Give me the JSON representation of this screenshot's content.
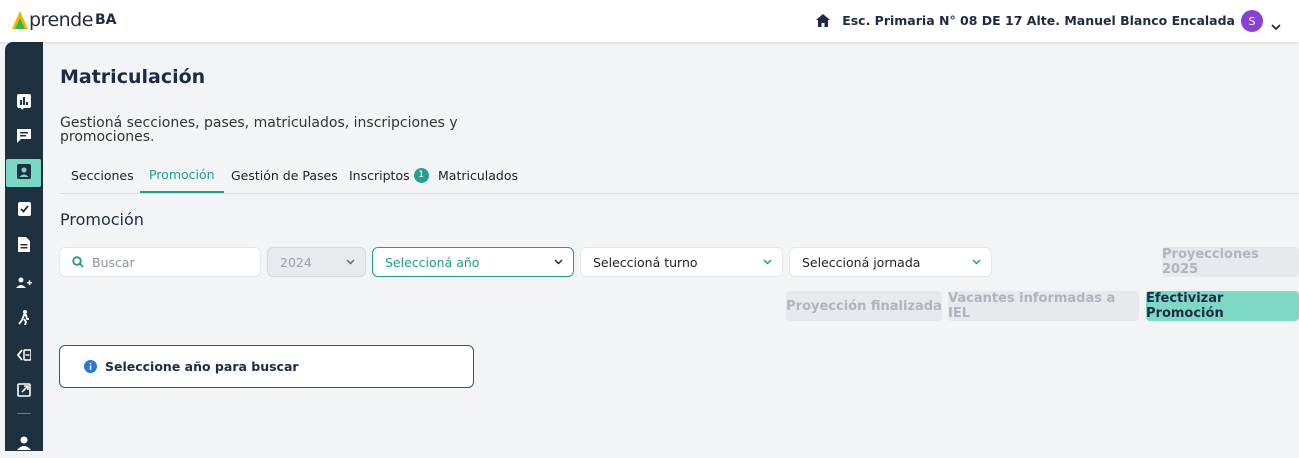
{
  "header": {
    "logo_word": "prende",
    "logo_suffix": "BA",
    "school_name": "Esc. Primaria N° 08 DE 17 Alte. Manuel Blanco Encalada",
    "avatar_initial": "S"
  },
  "sidebar": {
    "items": [
      {
        "icon": "chevron-right-icon"
      },
      {
        "icon": "bar-chart-icon"
      },
      {
        "icon": "chat-icon"
      },
      {
        "icon": "contact-badge-icon",
        "active": true
      },
      {
        "icon": "clipboard-check-icon"
      },
      {
        "icon": "document-icon"
      },
      {
        "icon": "group-add-icon"
      },
      {
        "icon": "running-person-icon"
      },
      {
        "icon": "transfer-icon"
      },
      {
        "icon": "external-link-icon"
      },
      {
        "icon": "person-icon"
      }
    ]
  },
  "page": {
    "title": "Matriculación",
    "subtitle": "Gestioná secciones, pases, matriculados, inscripciones y promociones."
  },
  "tabs": [
    {
      "label": "Secciones"
    },
    {
      "label": "Promoción",
      "active": true
    },
    {
      "label": "Gestión de Pases"
    },
    {
      "label": "Inscriptos",
      "badge": "1"
    },
    {
      "label": "Matriculados"
    }
  ],
  "section": {
    "title": "Promoción"
  },
  "filters": {
    "search_placeholder": "Buscar",
    "year_value": "2024",
    "grade_placeholder": "Seleccioná año",
    "shift_placeholder": "Seleccioná turno",
    "day_placeholder": "Seleccioná jornada"
  },
  "actions": {
    "projections": "Proyecciones 2025",
    "projection_done": "Proyección finalizada",
    "vacancies": "Vacantes informadas a IEL",
    "promote": "Efectivizar Promoción"
  },
  "alert": {
    "message": "Seleccione año para buscar"
  },
  "colors": {
    "accent": "#1f9c8a",
    "sidebar": "#1d3140",
    "primary_button": "#7ed8c6",
    "avatar": "#8b3fd9"
  }
}
